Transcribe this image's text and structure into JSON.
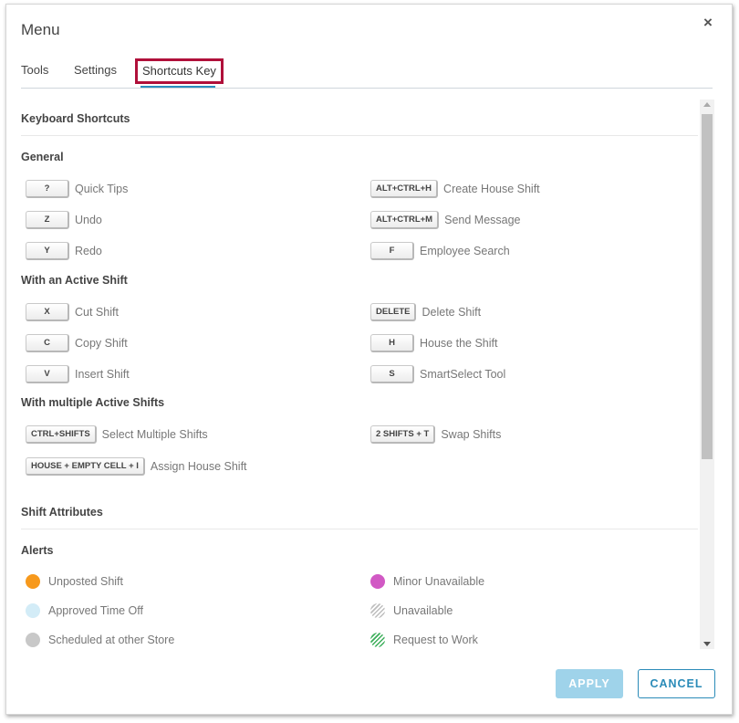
{
  "dialog": {
    "title": "Menu",
    "close_label": "×"
  },
  "tabs": [
    {
      "label": "Tools"
    },
    {
      "label": "Settings"
    },
    {
      "label": "Shortcuts Key"
    }
  ],
  "keyboard": {
    "title": "Keyboard Shortcuts",
    "general": {
      "title": "General",
      "left": [
        {
          "key": "?",
          "label": "Quick Tips"
        },
        {
          "key": "Z",
          "label": "Undo"
        },
        {
          "key": "Y",
          "label": "Redo"
        }
      ],
      "right": [
        {
          "key": "ALT+CTRL+H",
          "label": "Create House Shift"
        },
        {
          "key": "ALT+CTRL+M",
          "label": "Send Message"
        },
        {
          "key": "F",
          "label": "Employee Search"
        }
      ]
    },
    "active": {
      "title": "With an Active Shift",
      "left": [
        {
          "key": "X",
          "label": "Cut Shift"
        },
        {
          "key": "C",
          "label": "Copy Shift"
        },
        {
          "key": "V",
          "label": "Insert Shift"
        }
      ],
      "right": [
        {
          "key": "DELETE",
          "label": "Delete Shift"
        },
        {
          "key": "H",
          "label": "House the Shift"
        },
        {
          "key": "S",
          "label": "SmartSelect Tool"
        }
      ]
    },
    "multiple": {
      "title": "With multiple Active Shifts",
      "left": [
        {
          "key": "CTRL+SHIFTS",
          "label": "Select Multiple Shifts"
        },
        {
          "key": "HOUSE + EMPTY CELL + I",
          "label": "Assign House Shift"
        }
      ],
      "right": [
        {
          "key": "2 SHIFTS + T",
          "label": "Swap Shifts"
        }
      ]
    }
  },
  "attributes": {
    "title": "Shift Attributes",
    "alerts": {
      "title": "Alerts",
      "left": [
        {
          "label": "Unposted Shift",
          "color": "#f7991c",
          "style": "solid"
        },
        {
          "label": "Approved Time Off",
          "color": "#d3ecf7",
          "style": "solid"
        },
        {
          "label": "Scheduled at other Store",
          "color": "#c8c8c8",
          "style": "solid"
        }
      ],
      "right": [
        {
          "label": "Minor Unavailable",
          "color": "#d159c4",
          "style": "solid"
        },
        {
          "label": "Unavailable",
          "color": "#bdbdbd",
          "style": "hatched"
        },
        {
          "label": "Request to Work",
          "color": "#3cae5a",
          "style": "hatched"
        }
      ]
    }
  },
  "footer": {
    "apply_label": "APPLY",
    "cancel_label": "CANCEL"
  }
}
